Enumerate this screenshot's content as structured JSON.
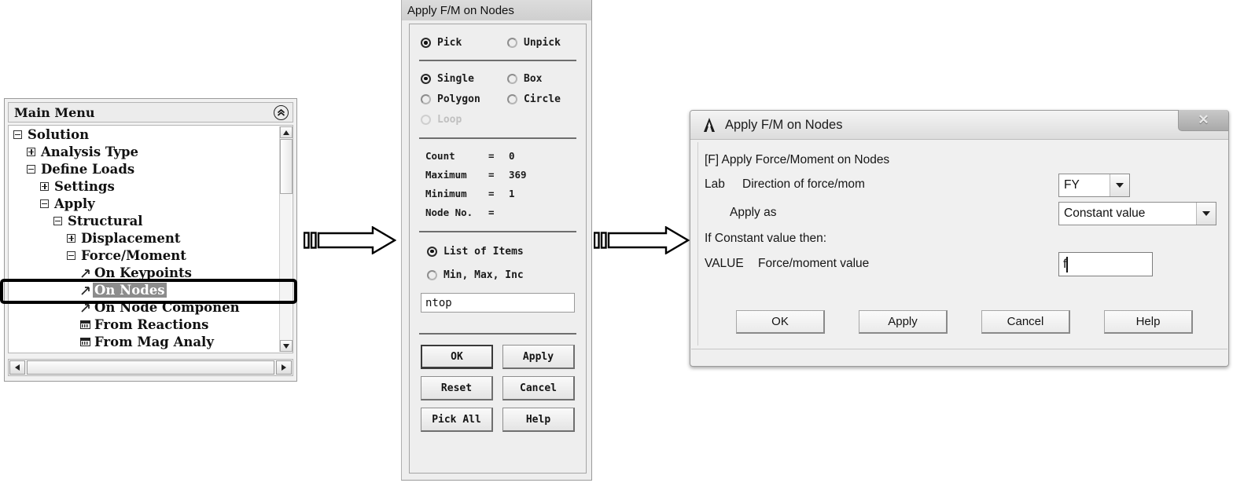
{
  "main_menu": {
    "title": "Main Menu",
    "collapse_icon": "chevron-double-up-icon",
    "tree": [
      {
        "label": "Solution",
        "indent": 0,
        "marker": "minus",
        "selected": false
      },
      {
        "label": "Analysis Type",
        "indent": 1,
        "marker": "plus",
        "selected": false
      },
      {
        "label": "Define Loads",
        "indent": 1,
        "marker": "minus",
        "selected": false
      },
      {
        "label": "Settings",
        "indent": 2,
        "marker": "plus",
        "selected": false
      },
      {
        "label": "Apply",
        "indent": 2,
        "marker": "minus",
        "selected": false
      },
      {
        "label": "Structural",
        "indent": 3,
        "marker": "minus",
        "selected": false
      },
      {
        "label": "Displacement",
        "indent": 4,
        "marker": "plus",
        "selected": false
      },
      {
        "label": "Force/Moment",
        "indent": 4,
        "marker": "minus",
        "selected": false
      },
      {
        "label": "On Keypoints",
        "indent": 5,
        "marker": "arrow",
        "selected": false
      },
      {
        "label": "On Nodes",
        "indent": 5,
        "marker": "arrow",
        "selected": true
      },
      {
        "label": "On Node Componen",
        "indent": 5,
        "marker": "arrow",
        "selected": false
      },
      {
        "label": "From Reactions",
        "indent": 5,
        "marker": "sheet",
        "selected": false
      },
      {
        "label": "From Mag Analy",
        "indent": 5,
        "marker": "sheet",
        "selected": false
      }
    ],
    "scroll": {
      "up_arrow": "scroll-up-icon",
      "down_arrow": "scroll-down-icon",
      "left_arrow": "scroll-left-icon",
      "right_arrow": "scroll-right-icon"
    }
  },
  "flow": {
    "arrow1": "right-block-arrow",
    "arrow2": "right-block-arrow"
  },
  "picker": {
    "title": "Apply F/M on Nodes",
    "mode": [
      {
        "label": "Pick",
        "selected": true,
        "disabled": false
      },
      {
        "label": "Unpick",
        "selected": false,
        "disabled": false
      }
    ],
    "shape": [
      {
        "label": "Single",
        "selected": true,
        "disabled": false
      },
      {
        "label": "Box",
        "selected": false,
        "disabled": false
      },
      {
        "label": "Polygon",
        "selected": false,
        "disabled": false
      },
      {
        "label": "Circle",
        "selected": false,
        "disabled": false
      },
      {
        "label": "Loop",
        "selected": false,
        "disabled": true
      }
    ],
    "stats": [
      {
        "key": "Count",
        "eq": "=",
        "value": "0"
      },
      {
        "key": "Maximum",
        "eq": "=",
        "value": "369"
      },
      {
        "key": "Minimum",
        "eq": "=",
        "value": "1"
      },
      {
        "key": "Node No.",
        "eq": "=",
        "value": ""
      }
    ],
    "entry_mode": [
      {
        "label": "List of Items",
        "selected": true
      },
      {
        "label": "Min, Max, Inc",
        "selected": false
      }
    ],
    "input_value": "ntop",
    "buttons": [
      {
        "label": "OK",
        "default": true
      },
      {
        "label": "Apply",
        "default": false
      },
      {
        "label": "Reset",
        "default": false
      },
      {
        "label": "Cancel",
        "default": false
      },
      {
        "label": "Pick All",
        "default": false
      },
      {
        "label": "Help",
        "default": false
      }
    ]
  },
  "fm_dialog": {
    "title": "Apply F/M on Nodes",
    "logo_icon": "ansys-a-logo-icon",
    "close_icon": "close-icon",
    "header": "[F]  Apply Force/Moment on Nodes",
    "lab_prefix": "Lab",
    "lab_text": "Direction of force/mom",
    "lab_value": "FY",
    "apply_as_label": "Apply as",
    "apply_as_value": "Constant value",
    "if_constant_text": "If Constant value then:",
    "value_prefix": "VALUE",
    "value_text": "Force/moment value",
    "value_input": "f",
    "buttons": [
      {
        "label": "OK"
      },
      {
        "label": "Apply"
      },
      {
        "label": "Cancel"
      },
      {
        "label": "Help"
      }
    ]
  }
}
